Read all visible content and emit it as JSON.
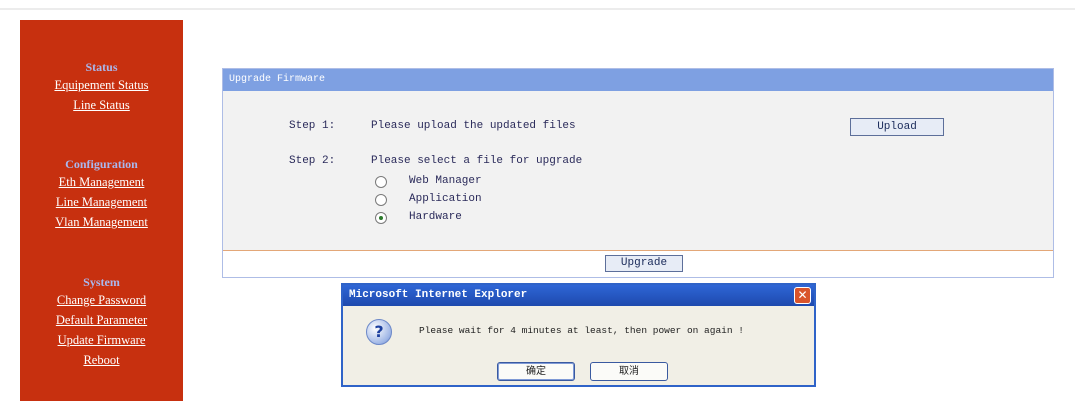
{
  "sidebar": {
    "status": {
      "heading": "Status",
      "items": [
        {
          "label": "Equipement Status"
        },
        {
          "label": "Line Status"
        }
      ]
    },
    "configuration": {
      "heading": "Configuration",
      "items": [
        {
          "label": "Eth Management"
        },
        {
          "label": "Line Management"
        },
        {
          "label": "Vlan Management"
        }
      ]
    },
    "system": {
      "heading": "System",
      "items": [
        {
          "label": "Change Password"
        },
        {
          "label": "Default Parameter"
        },
        {
          "label": "Update Firmware"
        },
        {
          "label": "Reboot"
        }
      ]
    }
  },
  "panel": {
    "title": "Upgrade Firmware",
    "step1": {
      "label": "Step 1:",
      "text": "Please upload the updated files",
      "button": "Upload"
    },
    "step2": {
      "label": "Step 2:",
      "text": "Please select a file for upgrade",
      "options": [
        {
          "label": "Web Manager",
          "checked": false
        },
        {
          "label": "Application",
          "checked": false
        },
        {
          "label": "Hardware",
          "checked": true
        }
      ]
    },
    "upgrade_button": "Upgrade"
  },
  "dialog": {
    "title": "Microsoft Internet Explorer",
    "icon": "question-icon",
    "message": "Please wait for 4 minutes at least, then power on again !",
    "ok_label": "确定",
    "cancel_label": "取消"
  },
  "colors": {
    "sidebar_bg": "#c7300f",
    "panel_header": "#7ea0e2",
    "dialog_title": "#2e66d6"
  }
}
